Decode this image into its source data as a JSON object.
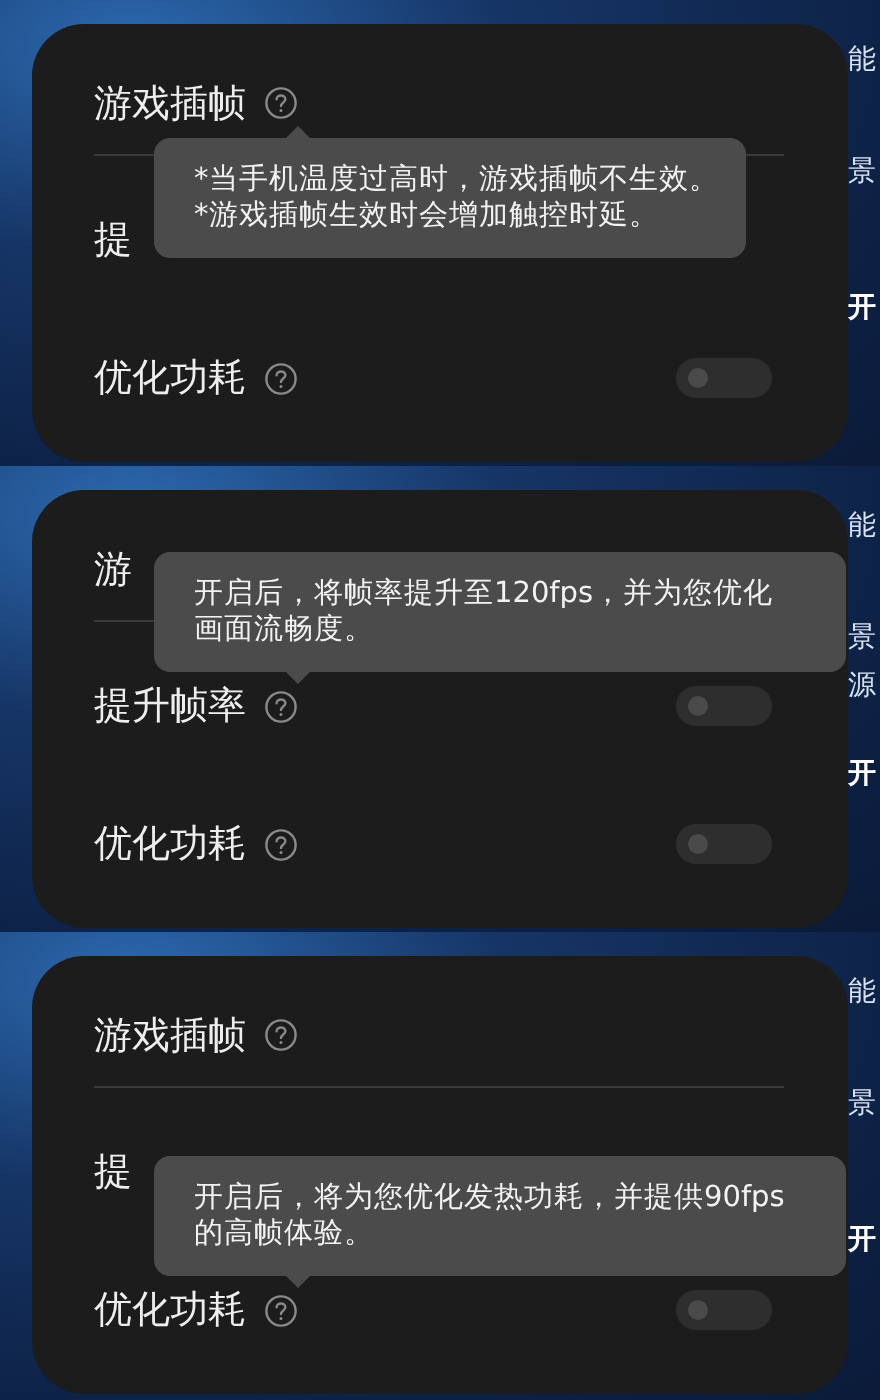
{
  "panels": [
    {
      "background_fragments": [
        {
          "text": "能",
          "kind": "tab"
        },
        {
          "text": "景",
          "kind": "header"
        },
        {
          "text": "开",
          "kind": "button"
        }
      ],
      "rows": [
        {
          "label": "游戏插帧",
          "help": true,
          "tooltip": {
            "kind": "below",
            "lines": [
              "*当手机温度过高时，游戏插帧不生效。",
              "*游戏插帧生效时会增加触控时延。"
            ]
          }
        },
        {
          "label": "提",
          "help": false
        },
        {
          "label": "优化功耗",
          "help": true,
          "switch_on": false
        }
      ]
    },
    {
      "background_fragments": [
        {
          "text": "能",
          "kind": "tab"
        },
        {
          "text": "景",
          "kind": "header"
        },
        {
          "text": "源",
          "kind": "label"
        },
        {
          "text": "开",
          "kind": "button"
        }
      ],
      "rows": [
        {
          "label": "游",
          "help": false
        },
        {
          "label": "提升帧率",
          "help": true,
          "switch_on": false,
          "tooltip": {
            "kind": "above",
            "lines": [
              "开启后，将帧率提升至120fps，并为您优化",
              "画面流畅度。"
            ]
          }
        },
        {
          "label": "优化功耗",
          "help": true,
          "switch_on": false
        }
      ]
    },
    {
      "background_fragments": [
        {
          "text": "能",
          "kind": "tab"
        },
        {
          "text": "景",
          "kind": "header"
        },
        {
          "text": "开",
          "kind": "button"
        }
      ],
      "rows": [
        {
          "label": "游戏插帧",
          "help": true
        },
        {
          "label": "提",
          "help": false
        },
        {
          "label": "优化功耗",
          "help": true,
          "switch_on": false,
          "tooltip": {
            "kind": "above",
            "lines": [
              "开启后，将为您优化发热功耗，并提供90fps",
              "的高帧体验。"
            ]
          }
        }
      ]
    }
  ]
}
